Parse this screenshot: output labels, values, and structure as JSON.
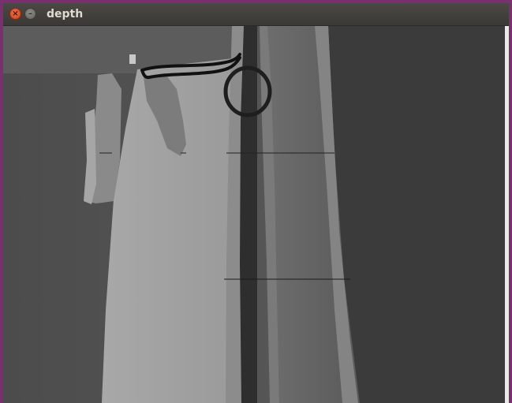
{
  "window": {
    "title": "depth",
    "close_glyph": "×",
    "minimize_glyph": "–"
  },
  "depth_view": {
    "description_icon": "depth-map"
  },
  "colors": {
    "titlebar": "#3c3b37",
    "close": "#e4552b",
    "desktop": "#7a2f6e"
  }
}
